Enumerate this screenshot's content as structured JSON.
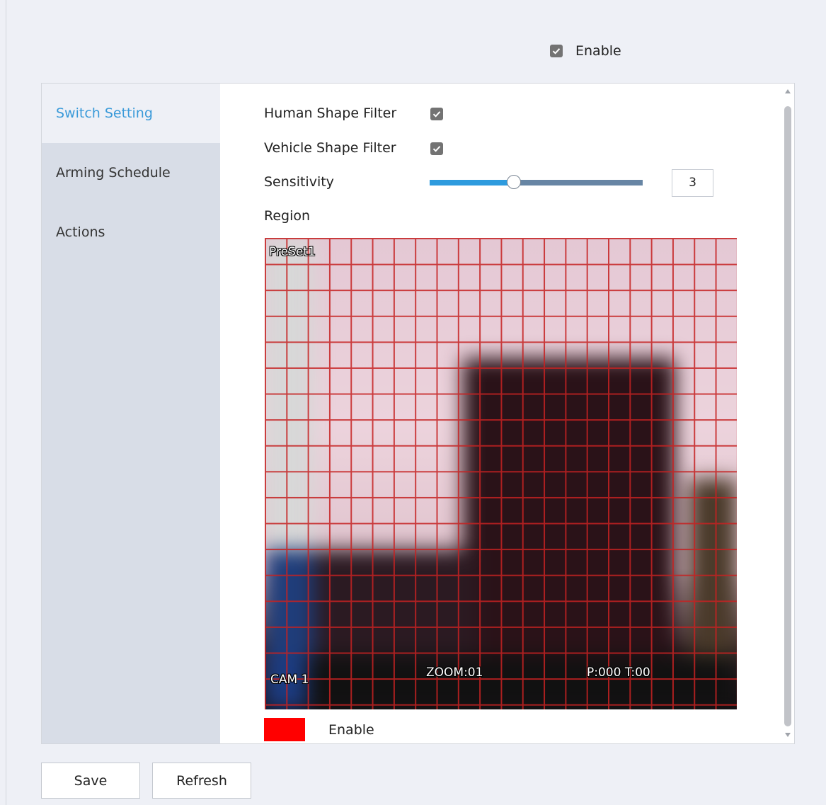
{
  "header": {
    "enable_label": "Enable",
    "enable_checked": true
  },
  "sidebar": {
    "items": [
      {
        "label": "Switch Setting",
        "active": true
      },
      {
        "label": "Arming Schedule",
        "active": false
      },
      {
        "label": "Actions",
        "active": false
      }
    ]
  },
  "settings": {
    "human_filter_label": "Human Shape Filter",
    "human_filter_checked": true,
    "vehicle_filter_label": "Vehicle Shape Filter",
    "vehicle_filter_checked": true,
    "sensitivity_label": "Sensitivity",
    "sensitivity_value": "3",
    "sensitivity_fraction": 0.4,
    "region_label": "Region"
  },
  "video": {
    "osd_preset": "PreSet1",
    "osd_cam": "CAM 1",
    "osd_zoom": "ZOOM:01",
    "osd_pt": "P:000 T:00"
  },
  "region_legend": {
    "color": "#ff0000",
    "label": "Enable"
  },
  "footer": {
    "save_label": "Save",
    "refresh_label": "Refresh"
  },
  "colors": {
    "accent": "#2e9bde",
    "active_text": "#3a9ad9",
    "grid": "#c62222"
  },
  "icons": [
    "check-icon",
    "scroll-up-icon",
    "scroll-down-icon"
  ]
}
